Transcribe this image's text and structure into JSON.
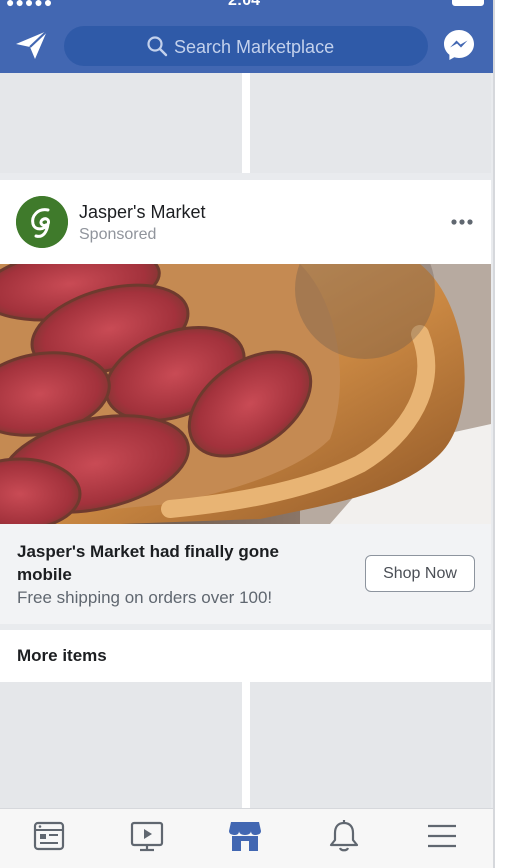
{
  "status_bar": {
    "signal": "●●●●● ",
    "time": "2:04"
  },
  "header": {
    "search_placeholder": "Search Marketplace",
    "icons": [
      "paper-plane-icon",
      "search-icon",
      "messenger-icon"
    ]
  },
  "ad": {
    "page_name": "Jasper's Market",
    "sponsored_label": "Sponsored",
    "avatar_icon": "jaspers-market-logo",
    "image_subject": "fig tart",
    "headline": "Jasper's Market had finally gone mobile",
    "description": "Free shipping on orders over 100!",
    "cta_label": "Shop Now"
  },
  "section": {
    "more_items_label": "More items"
  },
  "bottom_nav": {
    "items": [
      "news-feed-icon",
      "watch-icon",
      "marketplace-icon",
      "notifications-icon",
      "menu-icon"
    ],
    "active": "marketplace-icon",
    "active_color": "#4267b2",
    "inactive_color": "#606770"
  },
  "colors": {
    "brand": "#4267b2",
    "background": "#e9ebee"
  }
}
